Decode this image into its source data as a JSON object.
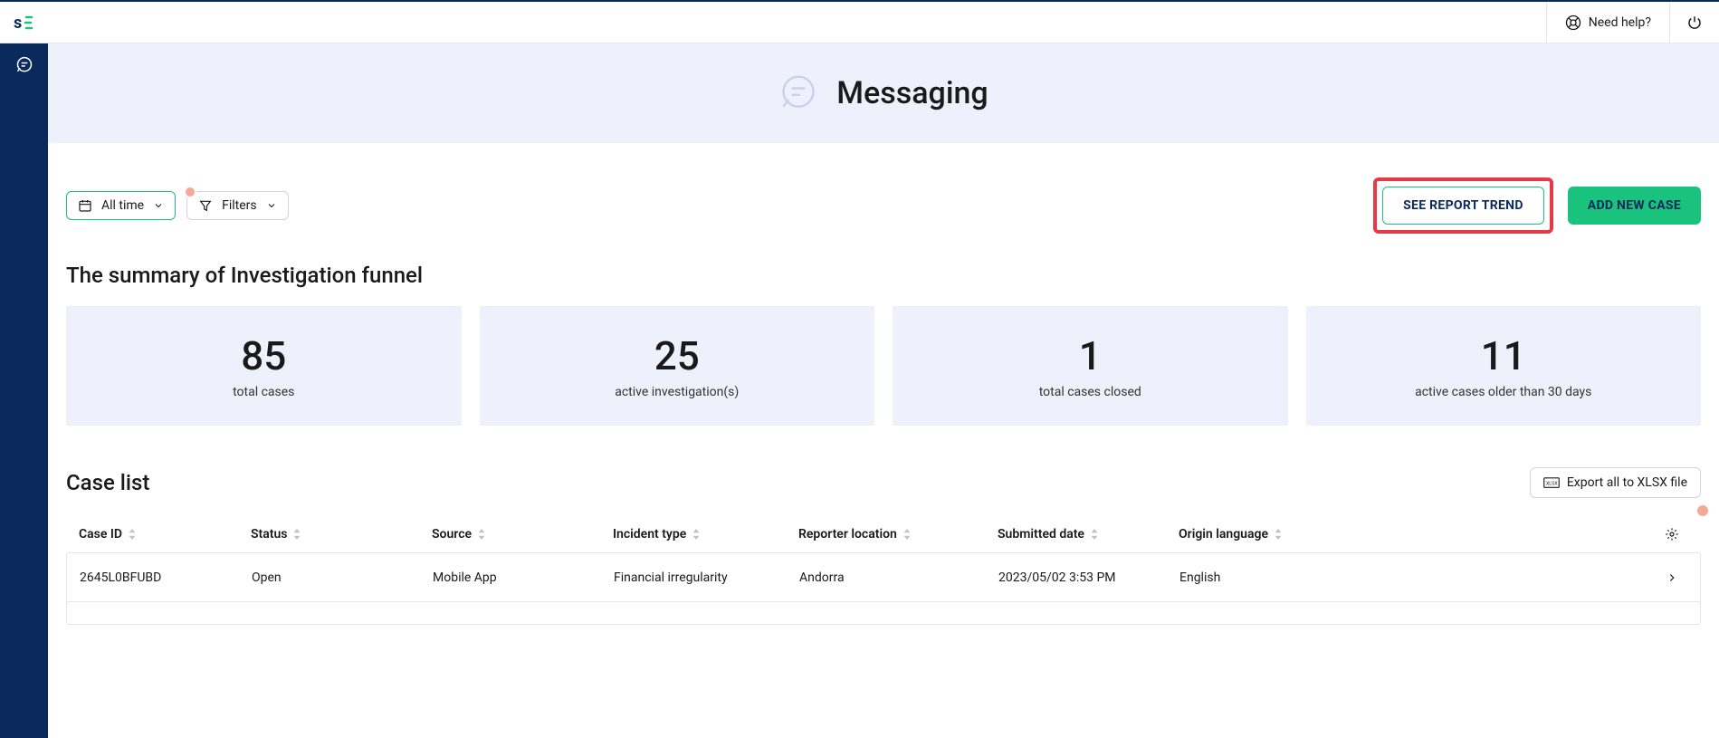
{
  "header": {
    "need_help": "Need help?"
  },
  "hero": {
    "title": "Messaging"
  },
  "filters": {
    "time_label": "All time",
    "filters_label": "Filters"
  },
  "actions": {
    "see_report_trend": "SEE REPORT TREND",
    "add_new_case": "ADD NEW CASE"
  },
  "summary": {
    "title": "The summary of Investigation funnel",
    "cards": [
      {
        "value": "85",
        "label": "total cases"
      },
      {
        "value": "25",
        "label": "active investigation(s)"
      },
      {
        "value": "1",
        "label": "total cases closed"
      },
      {
        "value": "11",
        "label": "active cases older than 30 days"
      }
    ]
  },
  "case_list": {
    "title": "Case list",
    "export_label": "Export all to XLSX file",
    "columns": {
      "case_id": "Case ID",
      "status": "Status",
      "source": "Source",
      "incident_type": "Incident type",
      "reporter_location": "Reporter location",
      "submitted_date": "Submitted date",
      "origin_language": "Origin language"
    },
    "rows": [
      {
        "case_id": "2645L0BFUBD",
        "status": "Open",
        "source": "Mobile App",
        "incident_type": "Financial irregularity",
        "reporter_location": "Andorra",
        "submitted_date": "2023/05/02 3:53 PM",
        "origin_language": "English"
      }
    ]
  }
}
